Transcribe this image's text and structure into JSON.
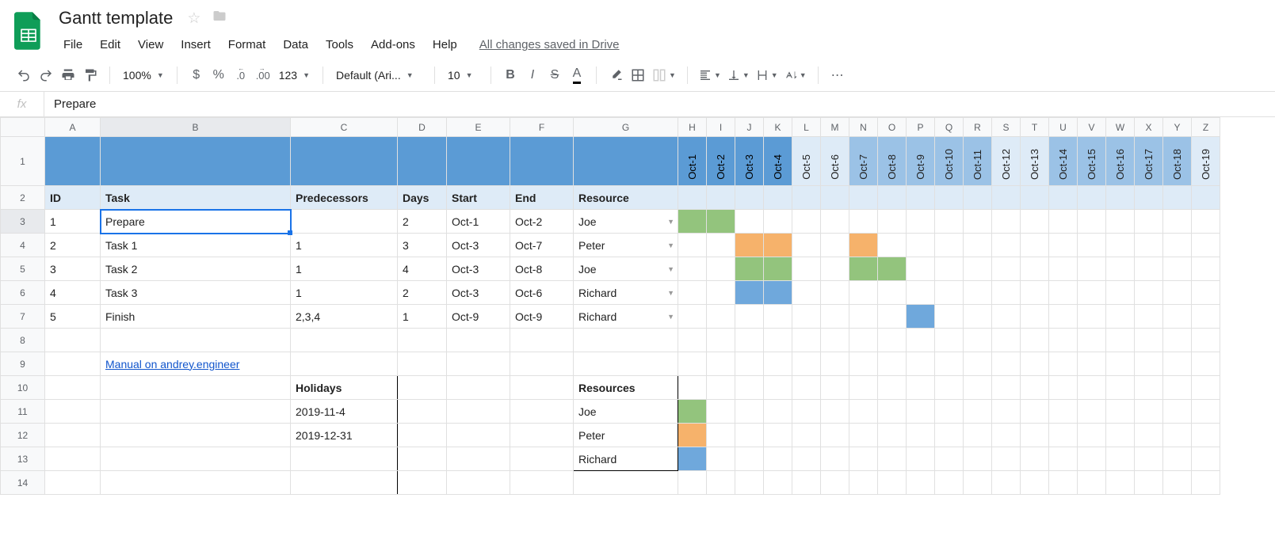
{
  "doc_title": "Gantt template",
  "menu": {
    "file": "File",
    "edit": "Edit",
    "view": "View",
    "insert": "Insert",
    "format": "Format",
    "data": "Data",
    "tools": "Tools",
    "addons": "Add-ons",
    "help": "Help"
  },
  "drive_status": "All changes saved in Drive",
  "toolbar": {
    "zoom": "100%",
    "currency": "$",
    "percent": "%",
    "dec_dec": ".0",
    "inc_dec": ".00",
    "format_num": "123",
    "font": "Default (Ari...",
    "font_size": "10",
    "more": "⋯"
  },
  "formula": {
    "fx": "fx",
    "value": "Prepare"
  },
  "columns": [
    "A",
    "B",
    "C",
    "D",
    "E",
    "F",
    "G",
    "H",
    "I",
    "J",
    "K",
    "L",
    "M",
    "N",
    "O",
    "P",
    "Q",
    "R",
    "S",
    "T",
    "U",
    "V",
    "W",
    "X",
    "Y",
    "Z"
  ],
  "col_widths": {
    "A": 70,
    "B": 240,
    "C": 135,
    "D": 62,
    "E": 80,
    "F": 80,
    "G": 132
  },
  "date_col_width": 36,
  "row_numbers": [
    1,
    2,
    3,
    4,
    5,
    6,
    7,
    8,
    9,
    10,
    11,
    12,
    13,
    14
  ],
  "dates": [
    "Oct-1",
    "Oct-2",
    "Oct-3",
    "Oct-4",
    "Oct-5",
    "Oct-6",
    "Oct-7",
    "Oct-8",
    "Oct-9",
    "Oct-10",
    "Oct-11",
    "Oct-12",
    "Oct-13",
    "Oct-14",
    "Oct-15",
    "Oct-16",
    "Oct-17",
    "Oct-18",
    "Oct-19"
  ],
  "date_shades": [
    "dark",
    "dark",
    "dark",
    "dark",
    "light",
    "light",
    "med",
    "med",
    "med",
    "med",
    "med",
    "light",
    "light",
    "med",
    "med",
    "med",
    "med",
    "med",
    "light"
  ],
  "headers": {
    "id": "ID",
    "task": "Task",
    "pred": "Predecessors",
    "days": "Days",
    "start": "Start",
    "end": "End",
    "resource": "Resource"
  },
  "tasks": [
    {
      "id": "1",
      "task": "Prepare",
      "pred": "",
      "days": "2",
      "start": "Oct-1",
      "end": "Oct-2",
      "resource": "Joe",
      "bars": [
        {
          "col": 0,
          "color": "green"
        },
        {
          "col": 1,
          "color": "green"
        }
      ]
    },
    {
      "id": "2",
      "task": "Task 1",
      "pred": "1",
      "days": "3",
      "start": "Oct-3",
      "end": "Oct-7",
      "resource": "Peter",
      "bars": [
        {
          "col": 2,
          "color": "orange"
        },
        {
          "col": 3,
          "color": "orange"
        },
        {
          "col": 6,
          "color": "orange"
        }
      ]
    },
    {
      "id": "3",
      "task": "Task 2",
      "pred": "1",
      "days": "4",
      "start": "Oct-3",
      "end": "Oct-8",
      "resource": "Joe",
      "bars": [
        {
          "col": 2,
          "color": "green"
        },
        {
          "col": 3,
          "color": "green"
        },
        {
          "col": 6,
          "color": "green"
        },
        {
          "col": 7,
          "color": "green"
        }
      ]
    },
    {
      "id": "4",
      "task": "Task 3",
      "pred": "1",
      "days": "2",
      "start": "Oct-3",
      "end": "Oct-6",
      "resource": "Richard",
      "bars": [
        {
          "col": 2,
          "color": "blue"
        },
        {
          "col": 3,
          "color": "blue"
        }
      ]
    },
    {
      "id": "5",
      "task": "Finish",
      "pred": "2,3,4",
      "days": "1",
      "start": "Oct-9",
      "end": "Oct-9",
      "resource": "Richard",
      "bars": [
        {
          "col": 8,
          "color": "blue"
        }
      ]
    }
  ],
  "link_text": "Manual on andrey.engineer",
  "holidays": {
    "title": "Holidays",
    "rows": [
      "2019-11-4",
      "2019-12-31"
    ]
  },
  "resources": {
    "title": "Resources",
    "rows": [
      {
        "name": "Joe",
        "color": "green"
      },
      {
        "name": "Peter",
        "color": "orange"
      },
      {
        "name": "Richard",
        "color": "blue"
      }
    ]
  },
  "selected_cell": {
    "row": 3,
    "col": "B"
  }
}
